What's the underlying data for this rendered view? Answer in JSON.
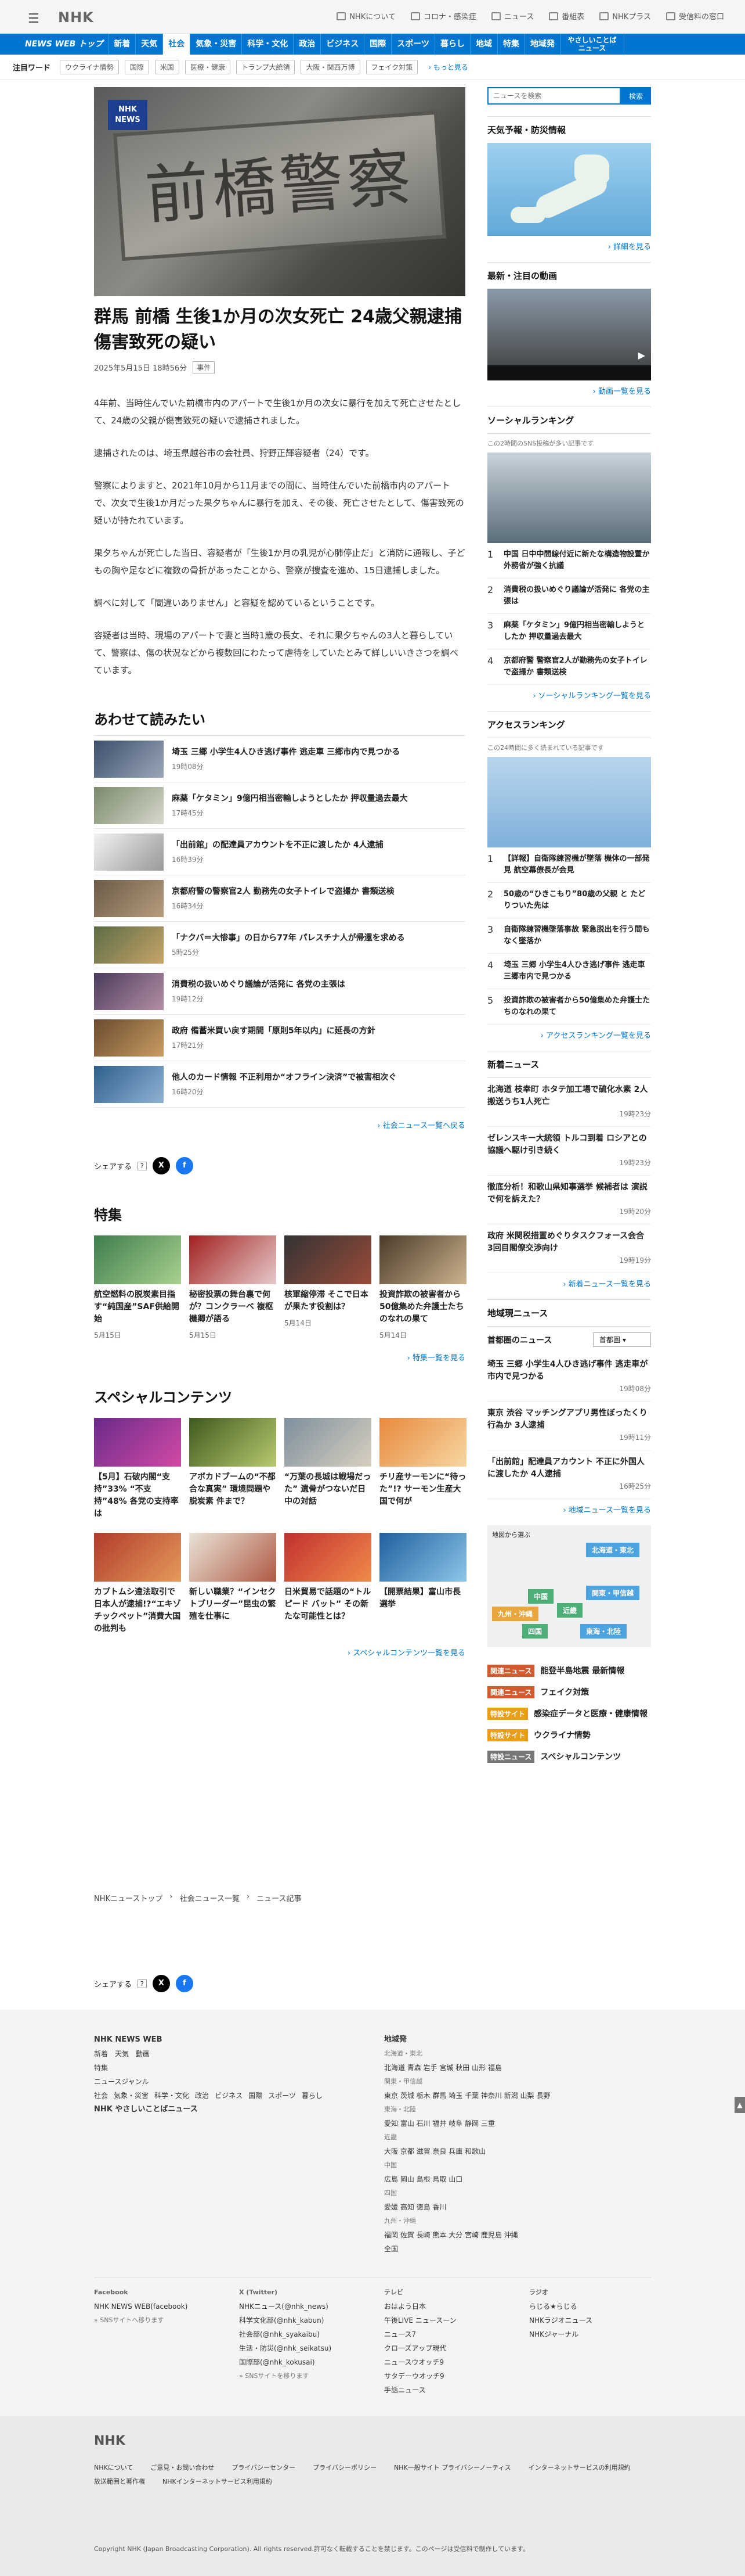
{
  "header": {
    "logo": "NHK",
    "links": [
      "NHKについて",
      "コロナ・感染症",
      "ニュース",
      "番組表",
      "NHKプラス",
      "受信料の窓口"
    ]
  },
  "gnav": [
    "NEWS WEB トップ",
    "新着",
    "天気",
    "社会",
    "気象・災害",
    "科学・文化",
    "政治",
    "ビジネス",
    "国際",
    "スポーツ",
    "暮らし",
    "地域",
    "特集",
    "地域発",
    "やさしいことば ニュース"
  ],
  "hot": {
    "label": "注目ワード",
    "tags": [
      "ウクライナ情勢",
      "国際",
      "米国",
      "医療・健康",
      "トランプ大統領",
      "大阪・関西万博",
      "フェイク対策"
    ],
    "more": "もっと見る"
  },
  "article": {
    "badge": "NHK NEWS",
    "sign": "前橋警察署",
    "title": "群馬 前橋 生後1か月の次女死亡 24歳父親逮捕 傷害致死の疑い",
    "date": "2025年5月15日 18時56分",
    "category": "事件",
    "paragraphs": [
      "4年前、当時住んでいた前橋市内のアパートで生後1か月の次女に暴行を加えて死亡させたとして、24歳の父親が傷害致死の疑いで逮捕されました。",
      "逮捕されたのは、埼玉県越谷市の会社員、狩野正輝容疑者（24）です。",
      "警察によりますと、2021年10月から11月までの間に、当時住んでいた前橋市内のアパートで、次女で生後1か月だった果夕ちゃんに暴行を加え、その後、死亡させたとして、傷害致死の疑いが持たれています。",
      "果夕ちゃんが死亡した当日、容疑者が「生後1か月の乳児が心肺停止だ」と消防に通報し、子どもの胸や足などに複数の骨折があったことから、警察が捜査を進め、15日逮捕しました。",
      "調べに対して「間違いありません」と容疑を認めているということです。",
      "容疑者は当時、現場のアパートで妻と当時1歳の長女、それに果夕ちゃんの3人と暮らしていて、警察は、傷の状況などから複数回にわたって虐待をしていたとみて詳しいいきさつを調べています。"
    ]
  },
  "related": {
    "heading": "あわせて読みたい",
    "items": [
      {
        "title": "埼玉 三郷 小学生4人ひき逃げ事件 逃走車 三郷市内で見つかる",
        "time": "19時08分"
      },
      {
        "title": "麻薬「ケタミン」9億円相当密輸しようとしたか 押収量過去最大",
        "time": "17時45分"
      },
      {
        "title": "「出前館」の配達員アカウントを不正に渡したか 4人逮捕",
        "time": "16時39分"
      },
      {
        "title": "京都府警の警察官2人 勤務先の女子トイレで盗撮か 書類送検",
        "time": "16時34分"
      },
      {
        "title": "「ナクバ＝大惨事」の日から77年 パレスチナ人が帰還を求める",
        "time": "5時25分"
      },
      {
        "title": "消費税の扱いめぐり議論が活発に 各党の主張は",
        "time": "19時12分"
      },
      {
        "title": "政府 備蓄米買い戻す期間「原則5年以内」に延長の方針",
        "time": "17時21分"
      },
      {
        "title": "他人のカード情報 不正利用か“オフライン決済”で被害相次ぐ",
        "time": "16時20分"
      }
    ],
    "more": "社会ニュース一覧へ戻る"
  },
  "share": {
    "label": "シェアする"
  },
  "feature": {
    "heading": "特集",
    "items": [
      {
        "title": "航空燃料の脱炭素目指す“純国産”SAF供給開始",
        "date": "5月15日"
      },
      {
        "title": "秘密投票の舞台裏で何が？コンクラーベ 複枢機卿が語る",
        "date": "5月15日"
      },
      {
        "title": "核軍縮停滞 そこで日本が果たす役割は？",
        "date": "5月14日"
      },
      {
        "title": "投資詐欺の被害者から50億集めた弁護士たちのなれの果て",
        "date": "5月14日"
      }
    ],
    "more": "特集一覧を見る"
  },
  "special": {
    "heading": "スペシャルコンテンツ",
    "items": [
      {
        "title": "【5月】石破内閣“支持”33% “不支持”48% 各党の支持率は"
      },
      {
        "title": "アボカドブームの“不都合な真実” 環境問題や脱炭素 件まで？"
      },
      {
        "title": "“万葉の長城は戦場だった” 遺骨がつないだ日中の対話"
      },
      {
        "title": "チリ産サーモンに“待った”!? サーモン生産大国で何が"
      },
      {
        "title": "カプトムシ違法取引で日本人が逮捕!?“エキゾチックペット”消費大国の批判も"
      },
      {
        "title": "新しい職業？“インセクトブリーダー”昆虫の繁殖を仕事に"
      },
      {
        "title": "日米貿易で話題の“トルピード バット” その新たな可能性とは？"
      },
      {
        "title": "【開票結果】富山市長選挙"
      }
    ],
    "more": "スペシャルコンテンツ一覧を見る"
  },
  "side": {
    "search_placeholder": "ニュースを検索",
    "search_btn": "検索",
    "weather": {
      "title": "天気予報・防災情報",
      "more": "詳細を見る"
    },
    "video": {
      "title": "最新・注目の動画",
      "more": "動画一覧を見る"
    },
    "social": {
      "title": "ソーシャルランキング",
      "sub": "この2時間のSNS投稿が多い記事です",
      "items": [
        "中国 日中中間線付近に新たな構造物設置か 外務省が強く抗議",
        "消費税の扱いめぐり議論が活発に 各党の主張は",
        "麻薬「ケタミン」9億円相当密輸しようとしたか 押収量過去最大",
        "京都府警 警察官2人が勤務先の女子トイレで盗撮か 書類送検"
      ],
      "more": "ソーシャルランキング一覧を見る"
    },
    "access": {
      "title": "アクセスランキング",
      "sub": "この24時間に多く読まれている記事です",
      "items": [
        "【詳報】自衛隊練習機が墜落 機体の一部発見 航空幕僚長が会見",
        "50歳の“ひきこもり”80歳の父親 と たどりついた先は",
        "自衛隊練習機墜落事故 緊急脱出を行う間もなく墜落か",
        "埼玉 三郷 小学生4人ひき逃げ事件 逃走車 三郷市内で見つかる",
        "投資詐欺の被害者から50億集めた弁護士たちのなれの果て"
      ],
      "more": "アクセスランキング一覧を見る"
    },
    "newest": {
      "title": "新着ニュース",
      "items": [
        {
          "title": "北海道 枝幸町 ホタテ加工場で硫化水素 2人搬送うち1人死亡",
          "time": "19時23分"
        },
        {
          "title": "ゼレンスキー大統領 トルコ到着 ロシアとの協議へ駆け引き続く",
          "time": "19時23分"
        },
        {
          "title": "徹底分析！和歌山県知事選挙 候補者は 演説で何を訴えた？",
          "time": "19時20分"
        },
        {
          "title": "政府 米関税措置めぐりタスクフォース会合 3回目閣僚交渉向け",
          "time": "19時19分"
        }
      ],
      "more": "新着ニュース一覧を見る"
    },
    "local": {
      "title": "地域現ニュース",
      "region_label": "首都圏のニュース",
      "region_select": "首都圏",
      "items": [
        {
          "title": "埼玉 三郷 小学生4人ひき逃げ事件 逃走車が市内で見つかる",
          "time": "19時08分"
        },
        {
          "title": "東京 渋谷 マッチングアプリ男性ぼったくり行為か 3人逮捕",
          "time": "19時11分"
        },
        {
          "title": "「出前館」配達員アカウント 不正に外国人に渡したか 4人逮捕",
          "time": "16時25分"
        }
      ],
      "more": "地域ニュース一覧を見る"
    },
    "map": {
      "label": "地図から選ぶ",
      "regions": [
        "北海道・東北",
        "中国",
        "近畿",
        "関東・甲信越",
        "九州・沖縄",
        "四国",
        "東海・北陸"
      ]
    },
    "tags": [
      {
        "lab": "関連ニュース",
        "text": "能登半島地震 最新情報",
        "color": "#d35a2d"
      },
      {
        "lab": "関連ニュース",
        "text": "フェイク対策",
        "color": "#d35a2d"
      },
      {
        "lab": "特設サイト",
        "text": "感染症データと医療・健康情報",
        "color": "#e89d1b"
      },
      {
        "lab": "特設サイト",
        "text": "ウクライナ情勢",
        "color": "#e89d1b"
      },
      {
        "lab": "特設ニュース",
        "text": "スペシャルコンテンツ",
        "color": "#777"
      }
    ]
  },
  "breadcrumb": [
    "NHKニューストップ",
    "社会ニュース一覧",
    "ニュース記事"
  ],
  "footer": {
    "col1": [
      "NHK NEWS WEB",
      "新着",
      "天気",
      "動画",
      "特集",
      "ニュースジャンル",
      "社会",
      "気象・災害",
      "科学・文化",
      "政治",
      "ビジネス",
      "国際",
      "スポーツ",
      "暮らし",
      "NHK やさしいことばニュース"
    ],
    "col2_title": "地域発",
    "regions": [
      "北海道・東北",
      "北海道 青森 岩手 宮城 秋田 山形 福島",
      "関東・甲信越",
      "東京 茨城 栃木 群馬 埼玉 千葉 神奈川 新潟 山梨 長野",
      "東海・北陸",
      "愛知 富山 石川 福井 岐阜 静岡 三重",
      "近畿",
      "大阪 京都 滋賀 奈良 兵庫 和歌山",
      "中国",
      "広島 岡山 島根 鳥取 山口",
      "四国",
      "愛媛 高知 徳島 香川",
      "九州・沖縄",
      "福岡 佐賀 長崎 熊本 大分 宮崎 鹿児島 沖縄",
      "全国"
    ],
    "sns": [
      {
        "title": "Facebook",
        "items": [
          "NHK NEWS WEB(facebook)",
          "» SNSサイトへ移ります"
        ]
      },
      {
        "title": "X (Twitter)",
        "items": [
          "NHKニュース(@nhk_news)",
          "科学文化部(@nhk_kabun)",
          "社会部(@nhk_syakaibu)",
          "生活・防災(@nhk_seikatsu)",
          "国際部(@nhk_kokusai)",
          "» SNSサイトを移ります"
        ]
      },
      {
        "title": "テレビ",
        "items": [
          "おはよう日本",
          "午後LIVE ニュースーン",
          "ニュース7",
          "クローズアップ現代",
          "ニュースウオッチ9",
          "サタデーウオッチ9",
          "手話ニュース"
        ]
      },
      {
        "title": "ラジオ",
        "items": [
          "らじる★らじる",
          "NHKラジオニュース",
          "NHKジャーナル"
        ]
      }
    ],
    "bottom": [
      "NHKについて",
      "ご意見・お問い合わせ",
      "プライバシーセンター",
      "プライバシーポリシー",
      "NHK一般サイト プライバシーノーティス",
      "インターネットサービスの利用規約",
      "放送範囲と著作権",
      "NHKインターネットサービス利用規約"
    ],
    "copyright": "Copyright NHK (Japan Broadcasting Corporation). All rights reserved.許可なく転載することを禁じます。このページは受信料で制作しています。"
  }
}
